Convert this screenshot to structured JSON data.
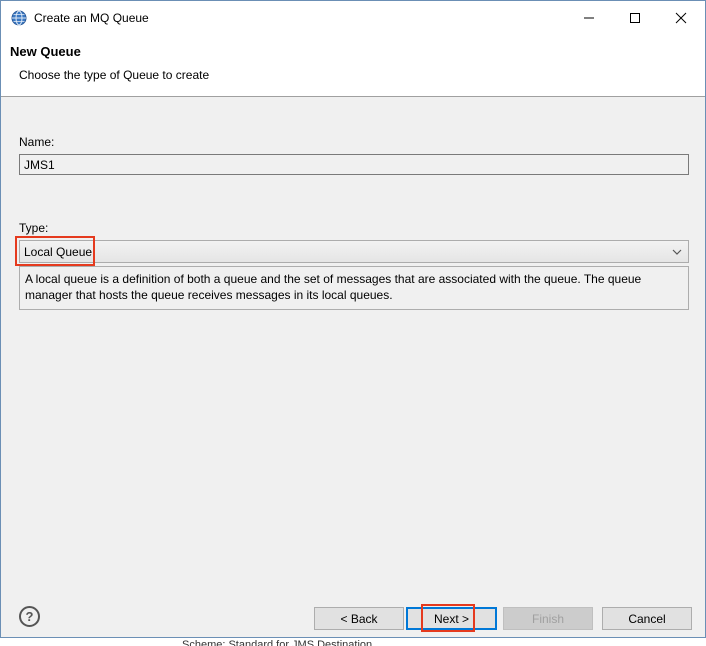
{
  "window": {
    "title": "Create an MQ Queue",
    "minimize_glyph": "—",
    "maximize_glyph": "☐",
    "close_glyph": "✕"
  },
  "header": {
    "title": "New Queue",
    "description": "Choose the type of Queue to create"
  },
  "form": {
    "name_label": "Name:",
    "name_value": "JMS1",
    "type_label": "Type:",
    "type_value": "Local Queue",
    "type_description": "A local queue is a definition of both a queue and the set of messages that are associated with the queue. The queue manager that hosts the queue receives messages in its local queues."
  },
  "footer": {
    "help_label": "?",
    "back_label": "< Back",
    "next_label": "Next >",
    "finish_label": "Finish",
    "cancel_label": "Cancel"
  },
  "background": {
    "partial_text": "Scheme: Standard for JMS Destination"
  },
  "colors": {
    "highlight": "#e53a1e",
    "default_button_border": "#0078d7"
  }
}
